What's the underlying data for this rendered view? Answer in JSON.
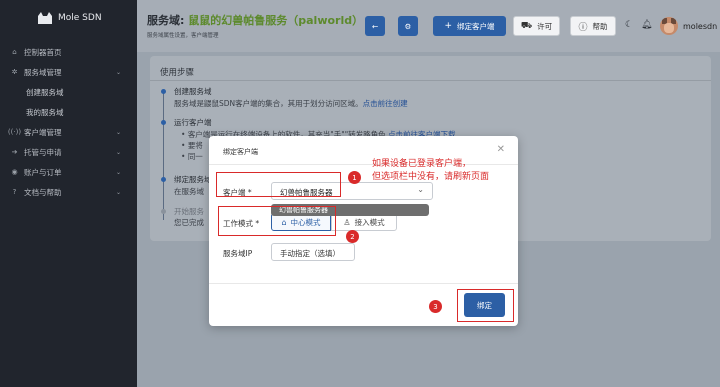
{
  "app": {
    "name": "Mole SDN"
  },
  "sidebar": {
    "items": [
      {
        "label": "控制器首页",
        "icon": "home-icon"
      },
      {
        "label": "服务域管理",
        "icon": "gear-icon",
        "expanded": true
      },
      {
        "label": "创建服务域",
        "sub": true
      },
      {
        "label": "我的服务域",
        "sub": true
      },
      {
        "label": "客户端管理",
        "icon": "broadcast-icon"
      },
      {
        "label": "托管与申请",
        "icon": "arrow-right-icon"
      },
      {
        "label": "账户与订单",
        "icon": "user-circle-icon"
      },
      {
        "label": "文档与帮助",
        "icon": "question-icon"
      }
    ]
  },
  "header": {
    "title_prefix": "服务域:",
    "title_name": "鼠鼠的幻兽帕鲁服务（palworld）",
    "subtitle": "服务域属性设置，客户端管理",
    "bind_client_label": "绑定客户端",
    "license_label": "许可",
    "help_label": "帮助",
    "username": "molesdn"
  },
  "card": {
    "title": "使用步骤",
    "steps": [
      {
        "title": "创建服务域",
        "text": "服务域是鼹鼠SDN客户端的集合，其用于划分访问区域。",
        "link": "点击前往创建"
      },
      {
        "title": "运行客户端",
        "bullets": [
          "客户端是运行在终端设备上的软件，其充当\"手\"\"转发路角色",
          "要将",
          "同一"
        ],
        "link": "点击前往客户端下载"
      },
      {
        "title": "绑定服务域",
        "text": "在服务域"
      },
      {
        "title": "开始服务",
        "text": "您已完成"
      }
    ]
  },
  "modal": {
    "title": "绑定客户端",
    "client_label": "客户端 *",
    "client_value": "幻兽帕鲁服务器",
    "dropdown_option": "幻兽帕鲁服务器",
    "mode_label": "工作模式 *",
    "mode_center": "中心模式",
    "mode_access": "接入模式",
    "ip_label": "服务域IP",
    "ip_value": "手动指定（选填）",
    "confirm_label": "绑定"
  },
  "annotations": {
    "num1": "1",
    "num2": "2",
    "num3": "3",
    "note_line1": "如果设备已登录客户端，",
    "note_line2": "但选项栏中没有，请刷新页面",
    "color": "#d92a2a"
  },
  "colors": {
    "accent": "#2c5fa5",
    "sidebar_bg": "#21252d",
    "title_green": "#5d8a2d"
  }
}
